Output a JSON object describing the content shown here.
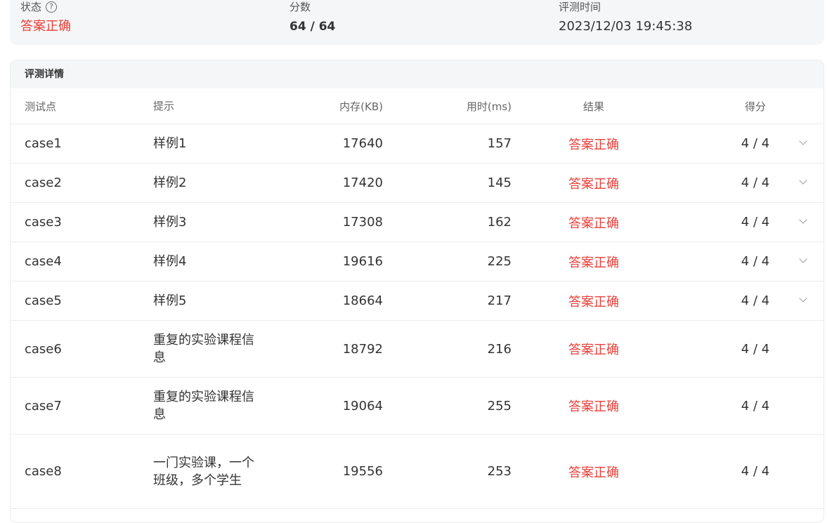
{
  "summary": {
    "status_label": "状态",
    "status_value": "答案正确",
    "score_label": "分数",
    "score_value": "64 / 64",
    "time_label": "评测时间",
    "time_value": "2023/12/03 19:45:38"
  },
  "details": {
    "title": "评测详情",
    "columns": {
      "case": "测试点",
      "hint": "提示",
      "memory": "内存(KB)",
      "time": "用时(ms)",
      "result": "结果",
      "score": "得分"
    },
    "rows": [
      {
        "case": "case1",
        "hint": "样例1",
        "memory": "17640",
        "time": "157",
        "result": "答案正确",
        "score": "4 / 4",
        "expandable": true
      },
      {
        "case": "case2",
        "hint": "样例2",
        "memory": "17420",
        "time": "145",
        "result": "答案正确",
        "score": "4 / 4",
        "expandable": true
      },
      {
        "case": "case3",
        "hint": "样例3",
        "memory": "17308",
        "time": "162",
        "result": "答案正确",
        "score": "4 / 4",
        "expandable": true
      },
      {
        "case": "case4",
        "hint": "样例4",
        "memory": "19616",
        "time": "225",
        "result": "答案正确",
        "score": "4 / 4",
        "expandable": true
      },
      {
        "case": "case5",
        "hint": "样例5",
        "memory": "18664",
        "time": "217",
        "result": "答案正确",
        "score": "4 / 4",
        "expandable": true
      },
      {
        "case": "case6",
        "hint": "重复的实验课程信息",
        "memory": "18792",
        "time": "216",
        "result": "答案正确",
        "score": "4 / 4",
        "expandable": false
      },
      {
        "case": "case7",
        "hint": "重复的实验课程信息",
        "memory": "19064",
        "time": "255",
        "result": "答案正确",
        "score": "4 / 4",
        "expandable": false
      },
      {
        "case": "case8",
        "hint": "一门实验课，一个班级，多个学生",
        "memory": "19556",
        "time": "253",
        "result": "答案正确",
        "score": "4 / 4",
        "expandable": false
      }
    ]
  },
  "colors": {
    "accepted": "#e8403a",
    "summary_bg": "#f5f6f7"
  },
  "icons": {
    "help": "question-circle-icon",
    "expand": "chevron-down-icon"
  }
}
